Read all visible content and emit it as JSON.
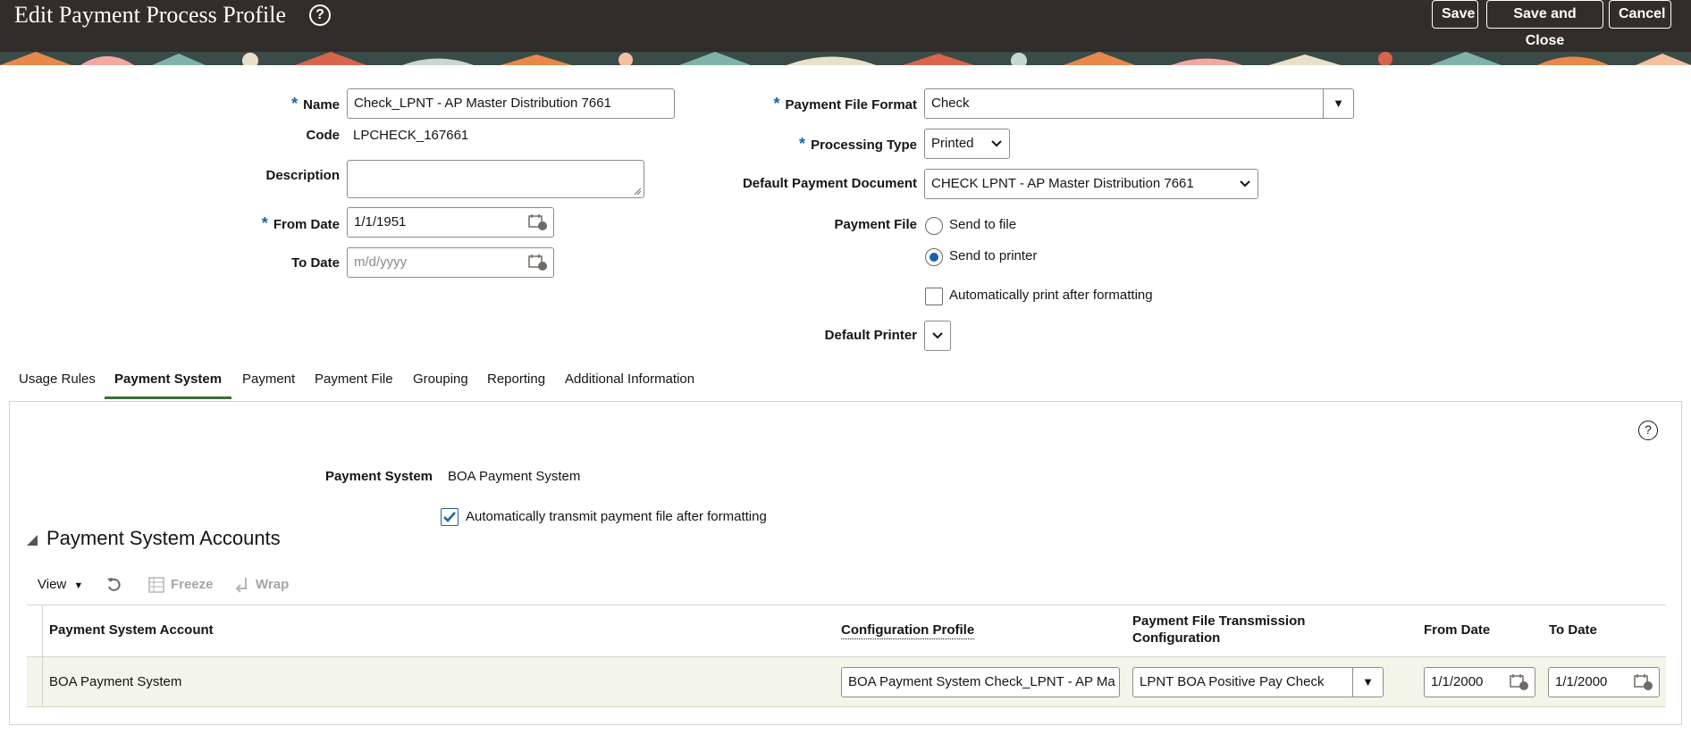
{
  "header": {
    "title": "Edit Payment Process Profile",
    "help_label": "?",
    "save_label": "Save",
    "save_close_label": "Save and Close",
    "cancel_label": "Cancel"
  },
  "form": {
    "name_label": "Name",
    "name_value": "Check_LPNT - AP Master Distribution 7661",
    "code_label": "Code",
    "code_value": "LPCHECK_167661",
    "description_label": "Description",
    "description_value": "",
    "from_date_label": "From Date",
    "from_date_value": "1/1/1951",
    "to_date_label": "To Date",
    "to_date_placeholder": "m/d/yyyy",
    "payment_file_format_label": "Payment File Format",
    "payment_file_format_value": "Check",
    "processing_type_label": "Processing Type",
    "processing_type_value": "Printed",
    "default_payment_document_label": "Default Payment Document",
    "default_payment_document_value": "CHECK LPNT - AP Master Distribution 7661",
    "payment_file_label": "Payment File",
    "send_to_file_label": "Send to file",
    "send_to_printer_label": "Send to printer",
    "auto_print_label": "Automatically print after formatting",
    "default_printer_label": "Default Printer",
    "required_marker": "*"
  },
  "tabs": [
    {
      "label": "Usage Rules"
    },
    {
      "label": "Payment System"
    },
    {
      "label": "Payment"
    },
    {
      "label": "Payment File"
    },
    {
      "label": "Grouping"
    },
    {
      "label": "Reporting"
    },
    {
      "label": "Additional Information"
    }
  ],
  "payment_system": {
    "help_label": "?",
    "label": "Payment System",
    "value": "BOA Payment System",
    "auto_transmit_label": "Automatically transmit payment file after formatting",
    "section_title": "Payment System Accounts"
  },
  "toolbar": {
    "view_label": "View",
    "freeze_label": "Freeze",
    "wrap_label": "Wrap"
  },
  "table": {
    "columns": [
      "Payment System Account",
      "Configuration Profile",
      "Payment File Transmission Configuration",
      "From Date",
      "To Date"
    ],
    "rows": [
      {
        "account": "BOA Payment System",
        "configuration_profile": "BOA Payment System Check_LPNT - AP Ma",
        "transmission_configuration": "LPNT BOA Positive Pay Check",
        "from_date": "1/1/2000",
        "to_date": "1/1/2000"
      }
    ]
  },
  "colors": {
    "header_bg": "#312d2a",
    "accent_blue": "#1b62a8",
    "tab_underline": "#3a6f3a",
    "row_highlight": "#f4f5e9"
  }
}
